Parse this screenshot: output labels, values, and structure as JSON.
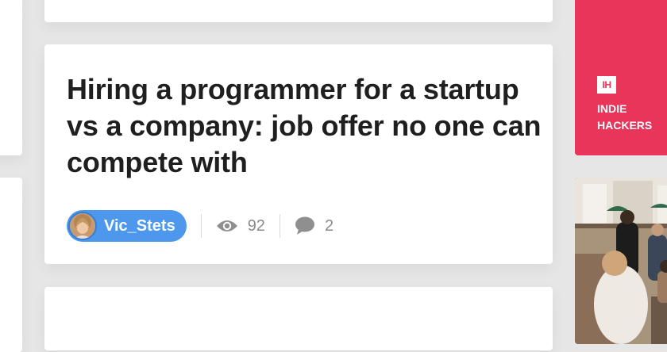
{
  "post": {
    "title": "Hiring a programmer for a startup vs a company: job offer no one can compete with",
    "author": {
      "name": "Vic_Stets"
    },
    "views": "92",
    "comments": "2"
  },
  "promo": {
    "logo": "IH",
    "name": "INDIE\nHACKERS"
  },
  "icons": {
    "views": "eye-icon",
    "comments": "speech-bubble-icon"
  },
  "colors": {
    "author_pill": "#4d97ec",
    "promo_background": "#e9355a",
    "page_background": "#e6e6e6"
  }
}
